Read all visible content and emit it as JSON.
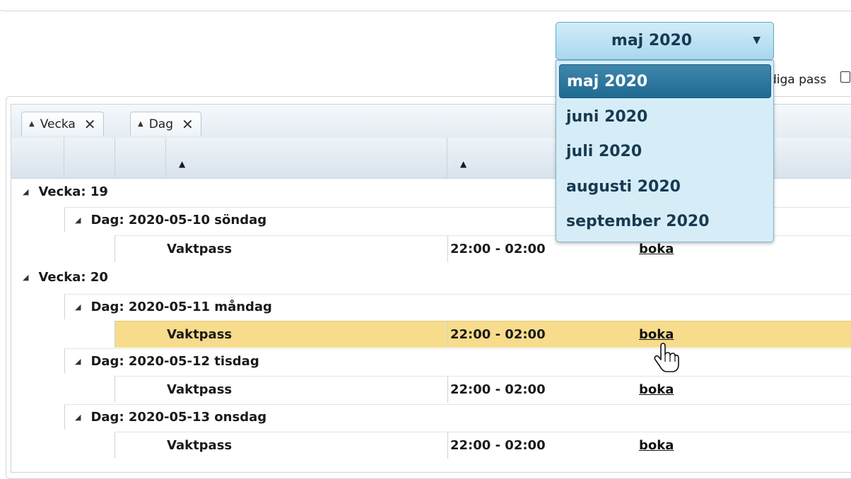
{
  "filter": {
    "label": "diga pass",
    "checked": false
  },
  "month_dropdown": {
    "selected": "maj 2020",
    "arrow_icon": "triangle-down-icon",
    "options": [
      "maj 2020",
      "juni 2020",
      "juli 2020",
      "augusti 2020",
      "september 2020"
    ],
    "active_index": 0
  },
  "grouping": {
    "chips": [
      {
        "label": "Vecka",
        "sort_icon": "sort-up-icon",
        "remove_icon": "close-icon"
      },
      {
        "label": "Dag",
        "sort_icon": "sort-up-icon",
        "remove_icon": "close-icon"
      }
    ]
  },
  "grid": {
    "weeks": [
      {
        "label": "Vecka: 19",
        "days": [
          {
            "label": "Dag: 2020-05-10 söndag",
            "rows": [
              {
                "name": "Vaktpass",
                "time": "22:00 - 02:00",
                "action": "boka"
              }
            ]
          }
        ]
      },
      {
        "label": "Vecka: 20",
        "days": [
          {
            "label": "Dag: 2020-05-11 måndag",
            "rows": [
              {
                "name": "Vaktpass",
                "time": "22:00 - 02:00",
                "action": "boka",
                "selected": true
              }
            ]
          },
          {
            "label": "Dag: 2020-05-12 tisdag",
            "rows": [
              {
                "name": "Vaktpass",
                "time": "22:00 - 02:00",
                "action": "boka"
              }
            ]
          },
          {
            "label": "Dag: 2020-05-13 onsdag",
            "rows": [
              {
                "name": "Vaktpass",
                "time": "22:00 - 02:00",
                "action": "boka"
              }
            ]
          }
        ]
      }
    ]
  },
  "colors": {
    "selected_row": "#f7dc8c",
    "dropdown_active": "#1f6a92",
    "dropdown_bg": "#d6edf8"
  }
}
